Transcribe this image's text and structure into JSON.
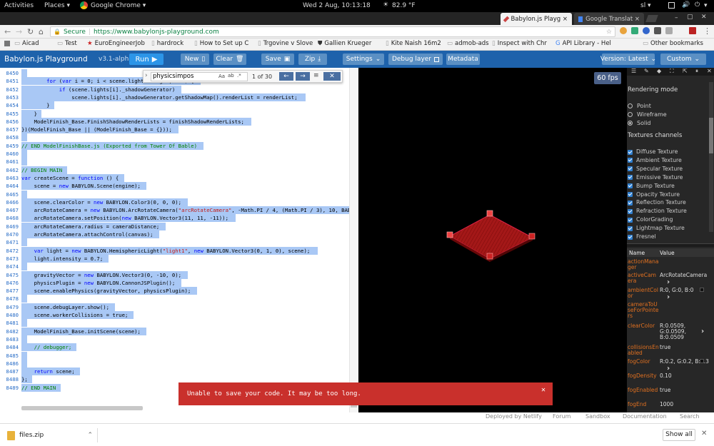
{
  "topbar": {
    "activities": "Activities",
    "places": "Places ▾",
    "app": "Google Chrome ▾",
    "clock": "Wed  2 Aug, 10:13:18",
    "weather": "82.9 °F",
    "user": "sl ▾"
  },
  "tabs": [
    {
      "label": "Babylon.js Playg ×"
    },
    {
      "label": "Google Translat ×"
    }
  ],
  "address": {
    "secure": "Secure",
    "url": "https://www.babylonjs-playground.com"
  },
  "bookmarks": [
    "Aicad",
    "Test",
    "EuroEngineerJob",
    "hardrock",
    "How to Set up C",
    "Trgovine v Slove",
    "Gallien Krueger",
    "Kite Naish 16m2",
    "admob-ads",
    "Inspect with Chr",
    "API Library - Hel",
    "Other bookmarks"
  ],
  "toolbar": {
    "title": "Babylon.js Playground",
    "version": "v3.1-alpha",
    "run": "Run",
    "new": "New",
    "clear": "Clear",
    "save": "Save",
    "zip": "Zip",
    "settings": "Settings",
    "debug": "Debug layer",
    "metadata": "Metadata",
    "engine": "Version: Latest",
    "custom": "Custom"
  },
  "find": {
    "query": "physicsimpos",
    "count": "1 of 30",
    "aa": "Aa"
  },
  "fps": "60 fps",
  "code": [
    {
      "n": "8450",
      "t": ""
    },
    {
      "n": "8451",
      "t": "        for (var i = 0; i < scene.lights.length; i++) {"
    },
    {
      "n": "8452",
      "t": "            if (scene.lights[i]._shadowGenerator)"
    },
    {
      "n": "8453",
      "t": "                scene.lights[i]._shadowGenerator.getShadowMap().renderList = renderList;"
    },
    {
      "n": "8454",
      "t": "        }"
    },
    {
      "n": "8455",
      "t": "    }"
    },
    {
      "n": "8456",
      "t": "    ModelFinish_Base.FinishShadowRenderLists = finishShadowRenderLists;"
    },
    {
      "n": "8457",
      "t": "})(ModelFinish_Base || (ModelFinish_Base = {}));"
    },
    {
      "n": "8458",
      "t": ""
    },
    {
      "n": "8459",
      "t": "// END ModelFinishBase.js (Exported from Tower Of Bable)"
    },
    {
      "n": "8460",
      "t": ""
    },
    {
      "n": "8461",
      "t": ""
    },
    {
      "n": "8462",
      "t": "// BEGIN MAIN"
    },
    {
      "n": "8463",
      "t": "var createScene = function () {"
    },
    {
      "n": "8464",
      "t": "    scene = new BABYLON.Scene(engine);"
    },
    {
      "n": "8465",
      "t": ""
    },
    {
      "n": "8466",
      "t": "    scene.clearColor = new BABYLON.Color3(0, 0, 0);"
    },
    {
      "n": "8467",
      "t": "    arcRotateCamera = new BABYLON.ArcRotateCamera(\"arcRotateCamera\", -Math.PI / 4, (Math.PI / 3), 10, BABYLON.Ve"
    },
    {
      "n": "8468",
      "t": "    arcRotateCamera.setPosition(new BABYLON.Vector3(11, 11, -11));"
    },
    {
      "n": "8469",
      "t": "    arcRotateCamera.radius = cameraDistance;"
    },
    {
      "n": "8470",
      "t": "    arcRotateCamera.attachControl(canvas);"
    },
    {
      "n": "8471",
      "t": ""
    },
    {
      "n": "8472",
      "t": "    var light = new BABYLON.HemisphericLight(\"light1\", new BABYLON.Vector3(0, 1, 0), scene);"
    },
    {
      "n": "8473",
      "t": "    light.intensity = 0.7;"
    },
    {
      "n": "8474",
      "t": ""
    },
    {
      "n": "8475",
      "t": "    gravityVector = new BABYLON.Vector3(0, -10, 0);"
    },
    {
      "n": "8476",
      "t": "    physicsPlugin = new BABYLON.CannonJSPlugin();"
    },
    {
      "n": "8477",
      "t": "    scene.enablePhysics(gravityVector, physicsPlugin);"
    },
    {
      "n": "8478",
      "t": ""
    },
    {
      "n": "8479",
      "t": "    scene.debugLayer.show();"
    },
    {
      "n": "8480",
      "t": "    scene.workerCollisions = true;"
    },
    {
      "n": "8481",
      "t": ""
    },
    {
      "n": "8482",
      "t": "    ModelFinish_Base.initScene(scene);"
    },
    {
      "n": "8483",
      "t": ""
    },
    {
      "n": "8484",
      "t": "    // debugger;"
    },
    {
      "n": "8485",
      "t": ""
    },
    {
      "n": "8486",
      "t": ""
    },
    {
      "n": "8487",
      "t": "    return scene;"
    },
    {
      "n": "8488",
      "t": "};"
    },
    {
      "n": "8489",
      "t": "// END MAIN"
    }
  ],
  "inspector": {
    "rendering_title": "Rendering mode",
    "render_modes": [
      "Point",
      "Wireframe",
      "Solid"
    ],
    "textures_title": "Textures channels",
    "textures": [
      "Diffuse Texture",
      "Ambient Texture",
      "Specular Texture",
      "Emissive Texture",
      "Bump Texture",
      "Opacity Texture",
      "Reflection Texture",
      "Refraction Texture",
      "ColorGrading",
      "Lightmap Texture",
      "Fresnel"
    ],
    "col_name": "Name",
    "col_value": "Value",
    "props": [
      {
        "name": "actionManager",
        "value": ""
      },
      {
        "name": "activeCamera",
        "value": "ArcRotateCamera"
      },
      {
        "name": "ambientColor",
        "value": "R:0, G:0, B:0"
      },
      {
        "name": "cameraToUseForPointers",
        "value": ""
      },
      {
        "name": "clearColor",
        "value": "R:0.0509, G:0.0509, B:0.0509"
      },
      {
        "name": "collisionsEnabled",
        "value": "true"
      },
      {
        "name": "fogColor",
        "value": "R:0.2, G:0.2, B:0.3"
      },
      {
        "name": "fogDensity",
        "value": "0.10"
      },
      {
        "name": "fogEnabled",
        "value": "true"
      },
      {
        "name": "fogEnd",
        "value": "1000"
      }
    ]
  },
  "footer_links": [
    "Deployed by Netlify",
    "Forum",
    "Sandbox",
    "Documentation",
    "Search"
  ],
  "download": {
    "file": "files.zip",
    "show_all": "Show all"
  },
  "toast": "Unable to save your code. It may be too long.",
  "colors": {
    "toolbar": "#1e62ab",
    "button": "#5b90c4",
    "toast": "#c9302c",
    "mesh": "#a41818"
  }
}
